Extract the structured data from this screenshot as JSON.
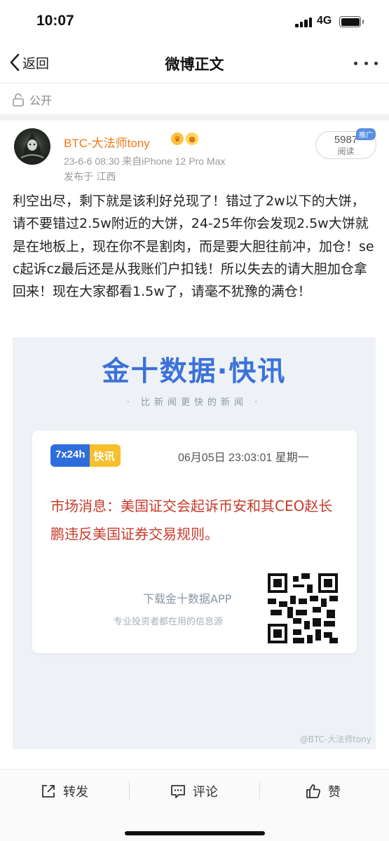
{
  "status_bar": {
    "time": "10:07",
    "network": "4G"
  },
  "nav": {
    "back_label": "返回",
    "title": "微博正文"
  },
  "visibility": "公开",
  "author": {
    "name": "BTC-大法师tony",
    "meta": "23-6-6 08:30  来自iPhone 12 Pro Max",
    "location": "发布于 江西"
  },
  "reads": {
    "count": "5987",
    "label": "阅读",
    "promo_tag": "推广"
  },
  "post": {
    "text": "利空出尽，剩下就是该利好兑现了！错过了2w以下的大饼，请不要错过2.5w附近的大饼，24-25年你会发现2.5w大饼就是在地板上，现在你不是割肉，而是要大胆往前冲，加仓！sec起诉cz最后还是从我账们户扣钱！所以失去的请大胆加仓拿回来！现在大家都看1.5w了，请毫不犹豫的满仓！"
  },
  "embed": {
    "title": "金十数据·快讯",
    "slogan": "· 比新闻更快的新闻 ·",
    "tag_a": "7x24h",
    "tag_b": "快讯",
    "date": "06月05日 23:03:01 星期一",
    "news": "市场消息：美国证交会起诉币安和其CEO赵长鹏违反美国证券交易规则。",
    "download_title": "下载金十数据APP",
    "download_sub": "专业投资者都在用的信息源",
    "watermark": "@BTC-大法师tony"
  },
  "actions": {
    "repost": "转发",
    "comment": "评论",
    "like": "赞"
  },
  "colors": {
    "author_name": "#f07a1a",
    "brand_blue": "#3b72d8",
    "news_red": "#c83a2a",
    "tag_yellow": "#f6bf2c"
  },
  "icons": [
    "back-chevron-icon",
    "more-icon",
    "lock-icon",
    "repost-icon",
    "comment-icon",
    "like-icon",
    "crown-badge-icon",
    "fish-badge-icon",
    "qr-code-icon"
  ]
}
